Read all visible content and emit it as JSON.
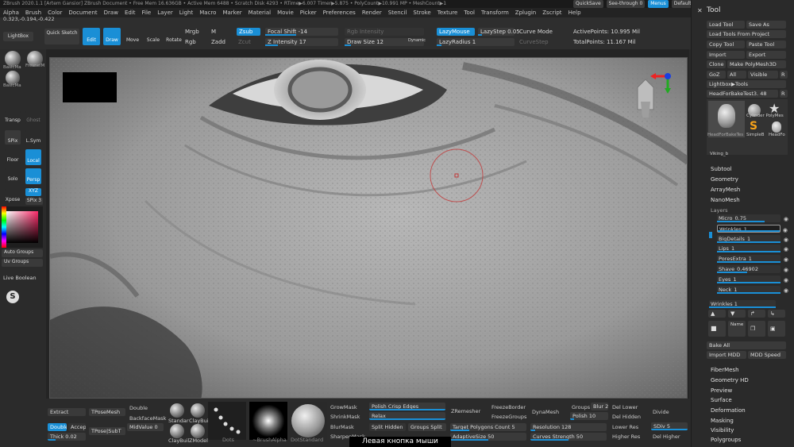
{
  "titlebar": {
    "text": "ZBrush 2020.1.1 [Artem Gansior]   ZBrush Document   • Free Mem 16.636GB • Active Mem 6488 • Scratch Disk 4293 • RTime▶6.007 Timer▶5.875 • PolyCount▶10.991 MP • MeshCount▶1",
    "quicksave": "QuickSave",
    "seethrough": "See-through 0",
    "menus": "Menus",
    "zscript": "DefaultZScript"
  },
  "menubar": [
    "Alpha",
    "Brush",
    "Color",
    "Document",
    "Draw",
    "Edit",
    "File",
    "Layer",
    "Light",
    "Macro",
    "Marker",
    "Material",
    "Movie",
    "Picker",
    "Preferences",
    "Render",
    "Stencil",
    "Stroke",
    "Texture",
    "Tool",
    "Transform",
    "Zplugin",
    "Zscript",
    "Help"
  ],
  "toolbar": {
    "lightbox": "LightBox",
    "quicksketch": "Quick Sketch",
    "edit": "Edit",
    "draw": "Draw",
    "move": "Move",
    "scale": "Scale",
    "rotate": "Rotate",
    "mrgb": "Mrgb",
    "rgb": "Rgb",
    "m": "M",
    "zadd": "Zadd",
    "zsub": "Zsub",
    "zcut": "Zcut",
    "focal_shift": "Focal Shift -14",
    "z_intensity": "Z Intensity 17",
    "rgb_intensity": "Rgb Intensity",
    "draw_size": "Draw Size 12",
    "dynamic": "Dynamic",
    "lazymouse": "LazyMouse",
    "lazystep": "LazyStep 0.05",
    "lazyradius": "LazyRadius 1",
    "curve_mode": "Curve Mode",
    "curve_step": "CurveStep",
    "active_points": "ActivePoints: 10.995 Mil",
    "total_points": "TotalPoints: 11.167 Mil"
  },
  "coords": "0.323,-0.194,-0.422",
  "leftshelf": {
    "brush1": "BasicMa",
    "brush2": "FresnelM",
    "brush3": "BasicMa",
    "transp": "Transp",
    "ghost": "Ghost",
    "spix": "SPix",
    "lsym": "L.Sym",
    "floor": "Floor",
    "local": "Local",
    "solo": "Solo",
    "persp": "Persp",
    "xpose": "Xpose",
    "xyz": "XYZ",
    "spix3": "SPix 3",
    "autogroups": "Auto Groups",
    "uvgroups": "Uv Groups",
    "liveboolean": "Live Boolean"
  },
  "rightpanel": {
    "tool": "Tool",
    "load_tool": "Load Tool",
    "save_as": "Save As",
    "load_from_project": "Load Tools From Project",
    "copy_tool": "Copy Tool",
    "paste_tool": "Paste Tool",
    "import": "Import",
    "export": "Export",
    "clone": "Clone",
    "make_polymesh": "Make PolyMesh3D",
    "goz": "GoZ",
    "all": "All",
    "visible": "Visible",
    "r": "R",
    "lightbox_tools": "Lightbox▶Tools",
    "current_tool": "HeadForBakeTest3. 48",
    "thumb_label": "HeadForBakeTes",
    "cylinder": "Cylinder PolyMes",
    "simplebrush": "SimpleB",
    "headforb": "HeadFo",
    "viking": "Viking_b",
    "subtool": "Subtool",
    "geometry": "Geometry",
    "arraymesh": "ArrayMesh",
    "nanomesh": "NanoMesh",
    "layers": "Layers",
    "layer_list": [
      {
        "name": "Micro",
        "value": "0.75"
      },
      {
        "name": "Wrinkles",
        "value": "1"
      },
      {
        "name": "BigDetails",
        "value": "1"
      },
      {
        "name": "Lips",
        "value": "1"
      },
      {
        "name": "PoresExtra",
        "value": "1"
      },
      {
        "name": "Shave",
        "value": "0.46902"
      },
      {
        "name": "Eyes",
        "value": "1"
      },
      {
        "name": "Neck",
        "value": "1"
      }
    ],
    "layer_fills": [
      0.75,
      1,
      1,
      1,
      1,
      0.47,
      1,
      1
    ],
    "wrinkles_active": "Wrinkles 1",
    "name": "Name",
    "bake_all": "Bake All",
    "import_mdd": "Import MDD",
    "mdd_speed": "MDD Speed",
    "fibermesh": "FiberMesh",
    "geometry_hd": "Geometry HD",
    "preview": "Preview",
    "surface": "Surface",
    "deformation": "Deformation",
    "masking": "Masking",
    "visibility": "Visibility",
    "polygroups": "Polygroups"
  },
  "bottombar": {
    "extract": "Extract",
    "tposemesh": "TPoseMesh",
    "double": "Double",
    "backfacemask": "BackfaceMask",
    "midvalue": "MidValue 0",
    "double2": "Double",
    "accept": "Accept",
    "thick": "Thick 0.02",
    "tposesubt": "TPose|SubT",
    "standard": "Standar",
    "claybuild": "ClayBuil",
    "claybuild2": "ClayBuil",
    "zmodeler": "ZModel",
    "dots": "Dots",
    "brushalpha": "~BrushAlpha",
    "dotsstandard": "DotStandard",
    "growmask": "GrowMask",
    "shrinkmask": "ShrinkMask",
    "blurmask": "BlurMask",
    "sharpenmask": "SharpenMask",
    "polish_crisp": "Polish Crisp Edges",
    "relax": "Relax",
    "split_hidden": "Split Hidden",
    "groups_split": "Groups Split",
    "target_polygons": "Target Polygons Count 5",
    "adaptivesize": "AdaptiveSize 50",
    "zremesher": "ZRemesher",
    "freezeborder": "FreezeBorder",
    "freezegroups": "FreezeGroups",
    "dynamesh": "DynaMesh",
    "resolution": "Resolution 128",
    "curves_strength": "Curves Strength 50",
    "groups": "Groups",
    "blur": "Blur 2",
    "polish": "Polish 10",
    "del_lower": "Del Lower",
    "del_hidden": "Del Hidden",
    "lower_res": "Lower Res",
    "higher_res": "Higher Res",
    "divide": "Divide",
    "sdiv": "SDiv 5",
    "del_higher": "Del Higher"
  },
  "caption": "Левая кнопка мыши"
}
